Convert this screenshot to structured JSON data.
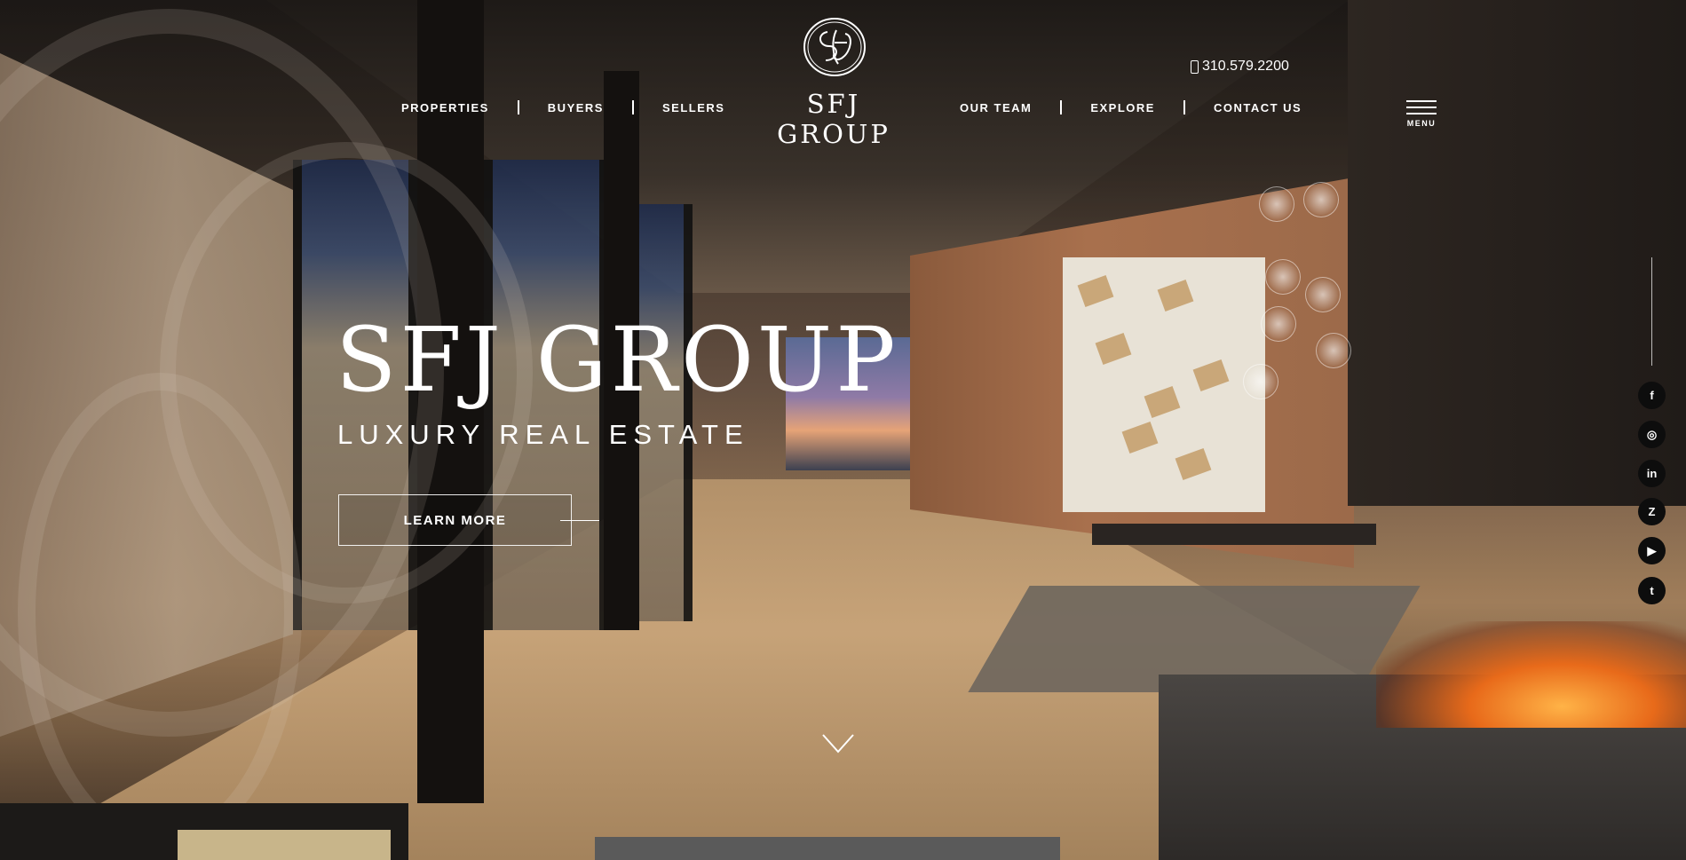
{
  "header": {
    "logo_text": "SFJ GROUP",
    "phone": "310.579.2200",
    "menu_label": "MENU",
    "nav_left": [
      {
        "label": "PROPERTIES"
      },
      {
        "label": "BUYERS"
      },
      {
        "label": "SELLERS"
      }
    ],
    "nav_right": [
      {
        "label": "OUR TEAM"
      },
      {
        "label": "EXPLORE"
      },
      {
        "label": "CONTACT US"
      }
    ]
  },
  "hero": {
    "title": "SFJ GROUP",
    "subtitle": "LUXURY REAL ESTATE",
    "cta_label": "LEARN MORE"
  },
  "social": [
    {
      "name": "facebook-icon",
      "glyph": "f"
    },
    {
      "name": "instagram-icon",
      "glyph": "◎"
    },
    {
      "name": "linkedin-icon",
      "glyph": "in"
    },
    {
      "name": "zillow-icon",
      "glyph": "Z"
    },
    {
      "name": "youtube-icon",
      "glyph": "▶"
    },
    {
      "name": "twitter-icon",
      "glyph": "t"
    }
  ],
  "colors": {
    "text": "#ffffff",
    "social_bg": "#0d0d0d",
    "accent_gold": "#c8b58a"
  }
}
